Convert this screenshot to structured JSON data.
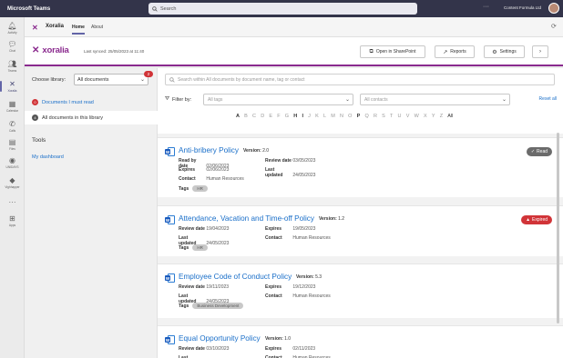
{
  "teams": {
    "app_title": "Microsoft Teams",
    "search_placeholder": "Search",
    "company": "Content Formula Ltd",
    "rail": [
      {
        "label": "Activity",
        "icon": "bell-icon"
      },
      {
        "label": "Chat",
        "icon": "chat-icon"
      },
      {
        "label": "Teams",
        "icon": "teams-icon"
      },
      {
        "label": "Xoralia",
        "icon": "xoralia-icon"
      },
      {
        "label": "Calendar",
        "icon": "calendar-icon"
      },
      {
        "label": "Calls",
        "icon": "phone-icon"
      },
      {
        "label": "Files",
        "icon": "files-icon"
      },
      {
        "label": "UNIDAYS",
        "icon": "unidays-icon"
      },
      {
        "label": "Vighhapper",
        "icon": "app-icon"
      },
      {
        "label": "...",
        "icon": "more-icon"
      },
      {
        "label": "Apps",
        "icon": "apps-icon"
      }
    ]
  },
  "apphead": {
    "name": "Xoralia",
    "tabs": [
      "Home",
      "About"
    ]
  },
  "xoralia": {
    "brand": "xoralia",
    "last_synced": "Last synced: 25/05/2023 at 11:40",
    "buttons": {
      "sharepoint": "Open in SharePoint",
      "reports": "Reports",
      "settings": "Settings"
    }
  },
  "left": {
    "library_label": "Choose library:",
    "library_value": "All documents",
    "library_badge": "2",
    "links": [
      {
        "count": "0",
        "label": "Documents I must read",
        "color": "#d13438"
      },
      {
        "count": "4",
        "label": "All documents in this library",
        "color": "#555555"
      }
    ],
    "tools_title": "Tools",
    "tools_link": "My dashboard"
  },
  "main": {
    "search_placeholder": "Search within All documents by document name, tag or contact",
    "filter_label": "Filter by:",
    "tags_placeholder": "All tags",
    "contacts_placeholder": "All contacts",
    "reset": "Reset all",
    "letters": [
      "A",
      "B",
      "C",
      "D",
      "E",
      "F",
      "G",
      "H",
      "I",
      "J",
      "K",
      "L",
      "M",
      "N",
      "O",
      "P",
      "Q",
      "R",
      "S",
      "T",
      "U",
      "V",
      "W",
      "X",
      "Y",
      "Z"
    ],
    "active_letters": [
      "A",
      "H",
      "I",
      "P"
    ],
    "all_label": "All"
  },
  "documents": [
    {
      "title": "Anti-bribery Policy",
      "version_label": "Version:",
      "version": "2.0",
      "fields_left": [
        [
          "Read by date",
          "02/06/2023"
        ],
        [
          "Expires",
          "02/06/2023"
        ],
        [
          "Contact",
          "Human Resources"
        ]
      ],
      "fields_right": [
        [
          "Review date",
          "03/05/2023"
        ],
        [
          "Last updated",
          "24/05/2023"
        ]
      ],
      "tags_label": "Tags",
      "tag": "HR",
      "status": "Read",
      "status_color": "#6b6b6b"
    },
    {
      "title": "Attendance, Vacation and Time-off Policy",
      "version_label": "Version:",
      "version": "1.2",
      "fields_left": [
        [
          "Review date",
          "19/04/2023"
        ],
        [
          "Last updated",
          "24/05/2023"
        ]
      ],
      "fields_right": [
        [
          "Expires",
          "19/05/2023"
        ],
        [
          "Contact",
          "Human Resources"
        ]
      ],
      "tags_label": "Tags",
      "tag": "HR",
      "status": "Expired",
      "status_color": "#d13438"
    },
    {
      "title": "Employee Code of Conduct Policy",
      "version_label": "Version:",
      "version": "5.3",
      "fields_left": [
        [
          "Review date",
          "19/11/2023"
        ],
        [
          "Last updated",
          "24/05/2023"
        ]
      ],
      "fields_right": [
        [
          "Expires",
          "19/12/2023"
        ],
        [
          "Contact",
          "Human Resources"
        ]
      ],
      "tags_label": "Tags",
      "tag": "Business Development",
      "status": "",
      "status_color": ""
    },
    {
      "title": "Equal Opportunity Policy",
      "version_label": "Version:",
      "version": "1.0",
      "fields_left": [
        [
          "Review date",
          "03/10/2023"
        ],
        [
          "Last updated",
          "24/05/2023"
        ]
      ],
      "fields_right": [
        [
          "Expires",
          "02/11/2023"
        ],
        [
          "Contact",
          "Human Resources"
        ]
      ],
      "tags_label": "",
      "tag": "",
      "status": "",
      "status_color": ""
    }
  ]
}
